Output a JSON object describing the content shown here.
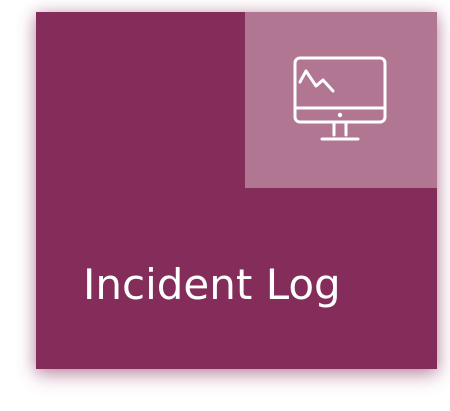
{
  "tile": {
    "label": "Incident Log",
    "icon": "monitor-chart-icon",
    "colors": {
      "background": "#842c5a",
      "icon_panel": "#b07692",
      "foreground": "#ffffff"
    }
  }
}
